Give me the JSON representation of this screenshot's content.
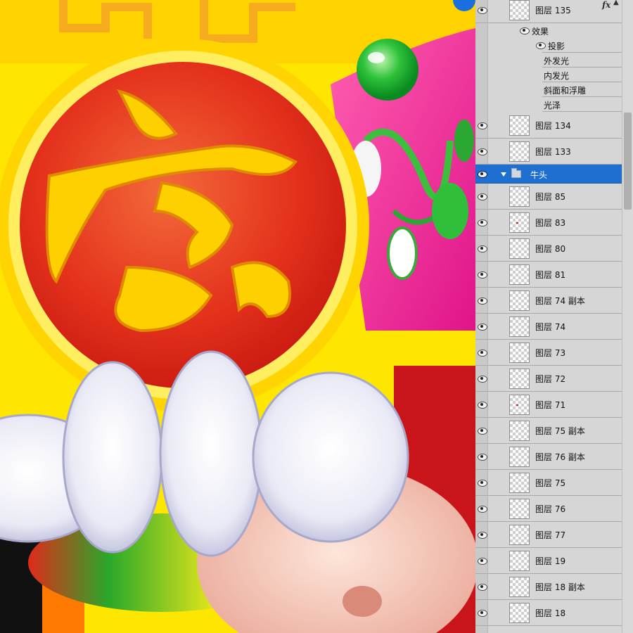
{
  "layers_panel": {
    "top_layer": {
      "name": "图层 135",
      "fx_mark": "fx",
      "fx_caret": "▲"
    },
    "effects": {
      "header": "效果",
      "items": [
        "投影",
        "外发光",
        "内发光",
        "斜面和浮雕",
        "光泽"
      ]
    },
    "layers_above_group": [
      "图层 134",
      "图层 133"
    ],
    "group": {
      "name": "牛头",
      "expanded": true
    },
    "group_layers": [
      "图层 85",
      "图层 83",
      "图层 80",
      "图层 81",
      "图层 74 副本",
      "图层 74",
      "图层 73",
      "图层 72",
      "图层 71",
      "图层 75 副本",
      "图层 76 副本",
      "图层 75",
      "图层 76",
      "图层 77",
      "图层 19",
      "图层 18 副本",
      "图层 18"
    ]
  },
  "colors": {
    "selection": "#1e6fd0",
    "panel_bg": "#d6d6d6"
  },
  "icons": [
    "eye-icon",
    "folder-icon",
    "disclosure-triangle-icon",
    "fx-icon",
    "layer-thumbnail"
  ]
}
